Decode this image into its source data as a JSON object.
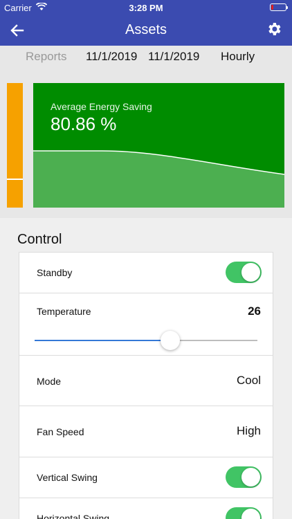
{
  "status_bar": {
    "carrier": "Carrier",
    "time": "3:28 PM",
    "battery_level": 0.15,
    "battery_color": "#e02020"
  },
  "nav": {
    "title": "Assets",
    "back_icon": "arrow-left-icon",
    "settings_icon": "gear-icon",
    "color": "#3b4bb0"
  },
  "filters": {
    "reports": "Reports",
    "date_from": "11/1/2019",
    "date_to": "11/1/2019",
    "interval": "Hourly"
  },
  "energy": {
    "label": "Average Energy Saving",
    "value": "80.86 %",
    "card_color": "#008c00",
    "side_color": "#f6a100"
  },
  "control": {
    "title": "Control",
    "standby": {
      "label": "Standby",
      "on": true
    },
    "temperature": {
      "label": "Temperature",
      "value": "26",
      "slider_level": 0.61
    },
    "mode": {
      "label": "Mode",
      "value": "Cool"
    },
    "fan_speed": {
      "label": "Fan Speed",
      "value": "High"
    },
    "vertical_swing": {
      "label": "Vertical Swing",
      "on": true
    },
    "horizontal_swing": {
      "label": "Horizontal Swing",
      "on": true
    },
    "toggle_color": "#41c465"
  }
}
